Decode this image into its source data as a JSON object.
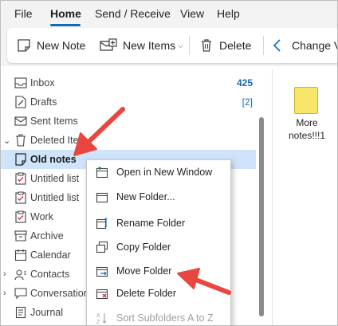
{
  "menu": {
    "tabs": [
      {
        "label": "File"
      },
      {
        "label": "Home"
      },
      {
        "label": "Send / Receive"
      },
      {
        "label": "View"
      },
      {
        "label": "Help"
      }
    ]
  },
  "ribbon": {
    "new_note": "New Note",
    "new_items": "New Items",
    "delete": "Delete",
    "change_view": "Change V"
  },
  "folders": [
    {
      "label": "Inbox",
      "icon": "inbox-icon",
      "count": "425"
    },
    {
      "label": "Drafts",
      "icon": "drafts-icon",
      "count": "[2]"
    },
    {
      "label": "Sent Items",
      "icon": "sent-icon"
    },
    {
      "label": "Deleted Items",
      "icon": "trash-icon",
      "display": "Deleted Item"
    },
    {
      "label": "Old notes",
      "icon": "note-folder-icon",
      "selected": true
    },
    {
      "label": "Untitled list",
      "icon": "list-icon"
    },
    {
      "label": "Untitled list",
      "icon": "list-icon"
    },
    {
      "label": "Work",
      "icon": "list-icon"
    },
    {
      "label": "Archive",
      "icon": "archive-icon"
    },
    {
      "label": "Calendar",
      "icon": "calendar-icon"
    },
    {
      "label": "Contacts",
      "icon": "contacts-icon"
    },
    {
      "label": "Conversation",
      "icon": "conversation-icon"
    },
    {
      "label": "Journal",
      "icon": "journal-icon"
    }
  ],
  "note": {
    "title_line1": "More",
    "title_line2": "notes!!!1"
  },
  "context_menu": {
    "items": [
      {
        "label": "Open in New Window",
        "icon": "open-window-icon"
      },
      {
        "label": "New Folder...",
        "icon": "new-folder-icon"
      },
      {
        "label": "Rename Folder",
        "icon": "rename-folder-icon"
      },
      {
        "label": "Copy Folder",
        "icon": "copy-folder-icon"
      },
      {
        "label": "Move Folder",
        "icon": "move-folder-icon"
      },
      {
        "label": "Delete Folder",
        "icon": "delete-folder-icon"
      },
      {
        "label": "Sort Subfolders A to Z",
        "icon": "sort-az-icon",
        "disabled": true
      }
    ]
  },
  "colors": {
    "accent": "#0f6cbd",
    "selected_bg": "#cfe4fa",
    "arrow": "#e8463f",
    "note_yellow": "#f7e66a"
  }
}
